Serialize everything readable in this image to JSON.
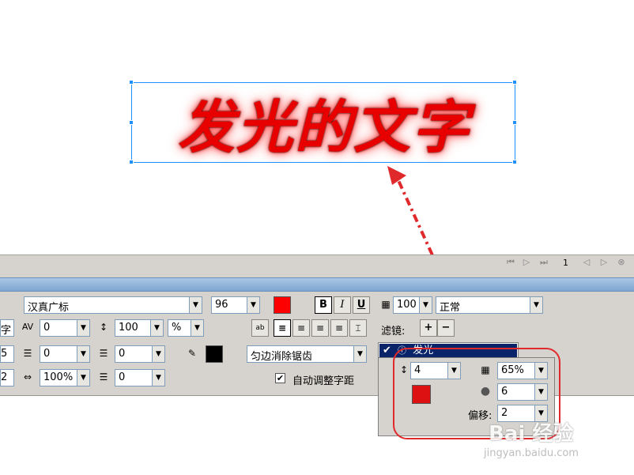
{
  "canvas": {
    "headline": "发光的文字"
  },
  "timeline": {
    "frame": "1"
  },
  "character": {
    "font_family": "汉真广标",
    "font_size": "96",
    "color": "#ff0000",
    "bold": "B",
    "italic": "I",
    "underline": "U",
    "tracking": "0",
    "line_height": "100",
    "line_unit": "%",
    "indent": "0",
    "space_before": "0",
    "horizontal_scale": "100%",
    "space_after": "0",
    "text_color": "#000000",
    "antialias": "匀边消除锯齿",
    "auto_kern_label": "自动调整字距",
    "left_partial_1": "字",
    "left_partial_2": "5",
    "left_partial_3": "2"
  },
  "object": {
    "opacity": "100",
    "blend_mode": "正常"
  },
  "filters": {
    "label": "滤镜:",
    "add": "+",
    "remove": "−",
    "selected": "发光",
    "glow_width": "4",
    "glow_opacity": "65%",
    "glow_color": "#dd1111",
    "softness": "6",
    "offset_label": "偏移:",
    "offset": "2"
  },
  "watermark": {
    "brand": "Bai 经验",
    "url": "jingyan.baidu.com"
  },
  "colors": {
    "accent_red": "#e0292b",
    "selection_blue": "#1e90ff",
    "panel": "#d6d3ce"
  }
}
